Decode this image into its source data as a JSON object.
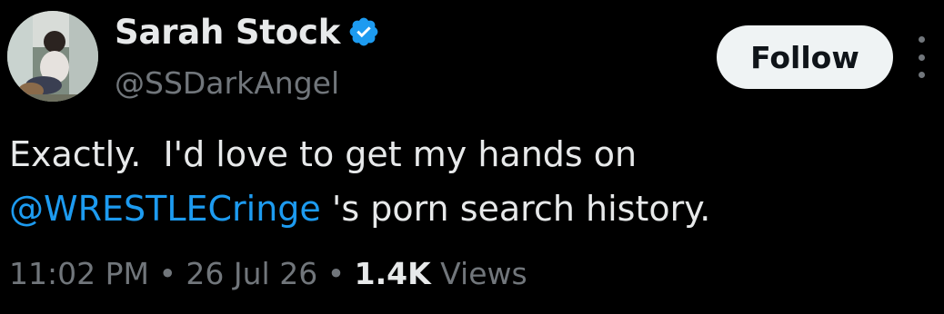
{
  "author": {
    "display_name": "Sarah Stock",
    "handle": "@SSDarkAngel",
    "verified_icon": "verified-badge-icon",
    "verified_color": "#1d9bf0"
  },
  "actions": {
    "follow_label": "Follow",
    "more_icon": "more-vertical-icon"
  },
  "tweet": {
    "text_line1": "Exactly.  I'd love to get my hands on",
    "mention": "@WRESTLECringe",
    "text_after_mention": " 's porn search history."
  },
  "meta": {
    "time": "11:02 PM",
    "sep1": " • ",
    "date": "26 Jul 26",
    "sep2": " • ",
    "views_count": "1.4K",
    "views_label": " Views"
  },
  "colors": {
    "background": "#000000",
    "text": "#e7e9ea",
    "muted": "#71767b",
    "link": "#1d9bf0",
    "button_bg": "#eff3f4"
  }
}
